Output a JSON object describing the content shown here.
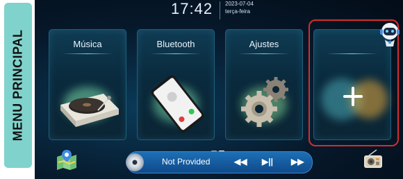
{
  "side_label": "MENU PRINCIPAL",
  "status": {
    "time": "17:42",
    "date": "2023-07-04",
    "weekday": "terça-feira"
  },
  "cards": [
    {
      "title": "Música"
    },
    {
      "title": "Bluetooth"
    },
    {
      "title": "Ajustes"
    },
    {
      "title": ""
    }
  ],
  "player": {
    "track": "Not Provided",
    "prev_symbol": "◀◀",
    "play_pause_symbol": "▶||",
    "next_symbol": "▶▶"
  },
  "icons": {
    "map": "map-icon",
    "robot": "robot-icon",
    "radio": "radio-icon",
    "add": "plus-icon",
    "disc": "disc-icon"
  },
  "colors": {
    "side_pill": "#7fd3cc",
    "highlight": "#d62d2d",
    "player_bar": "#1d6fb6"
  }
}
